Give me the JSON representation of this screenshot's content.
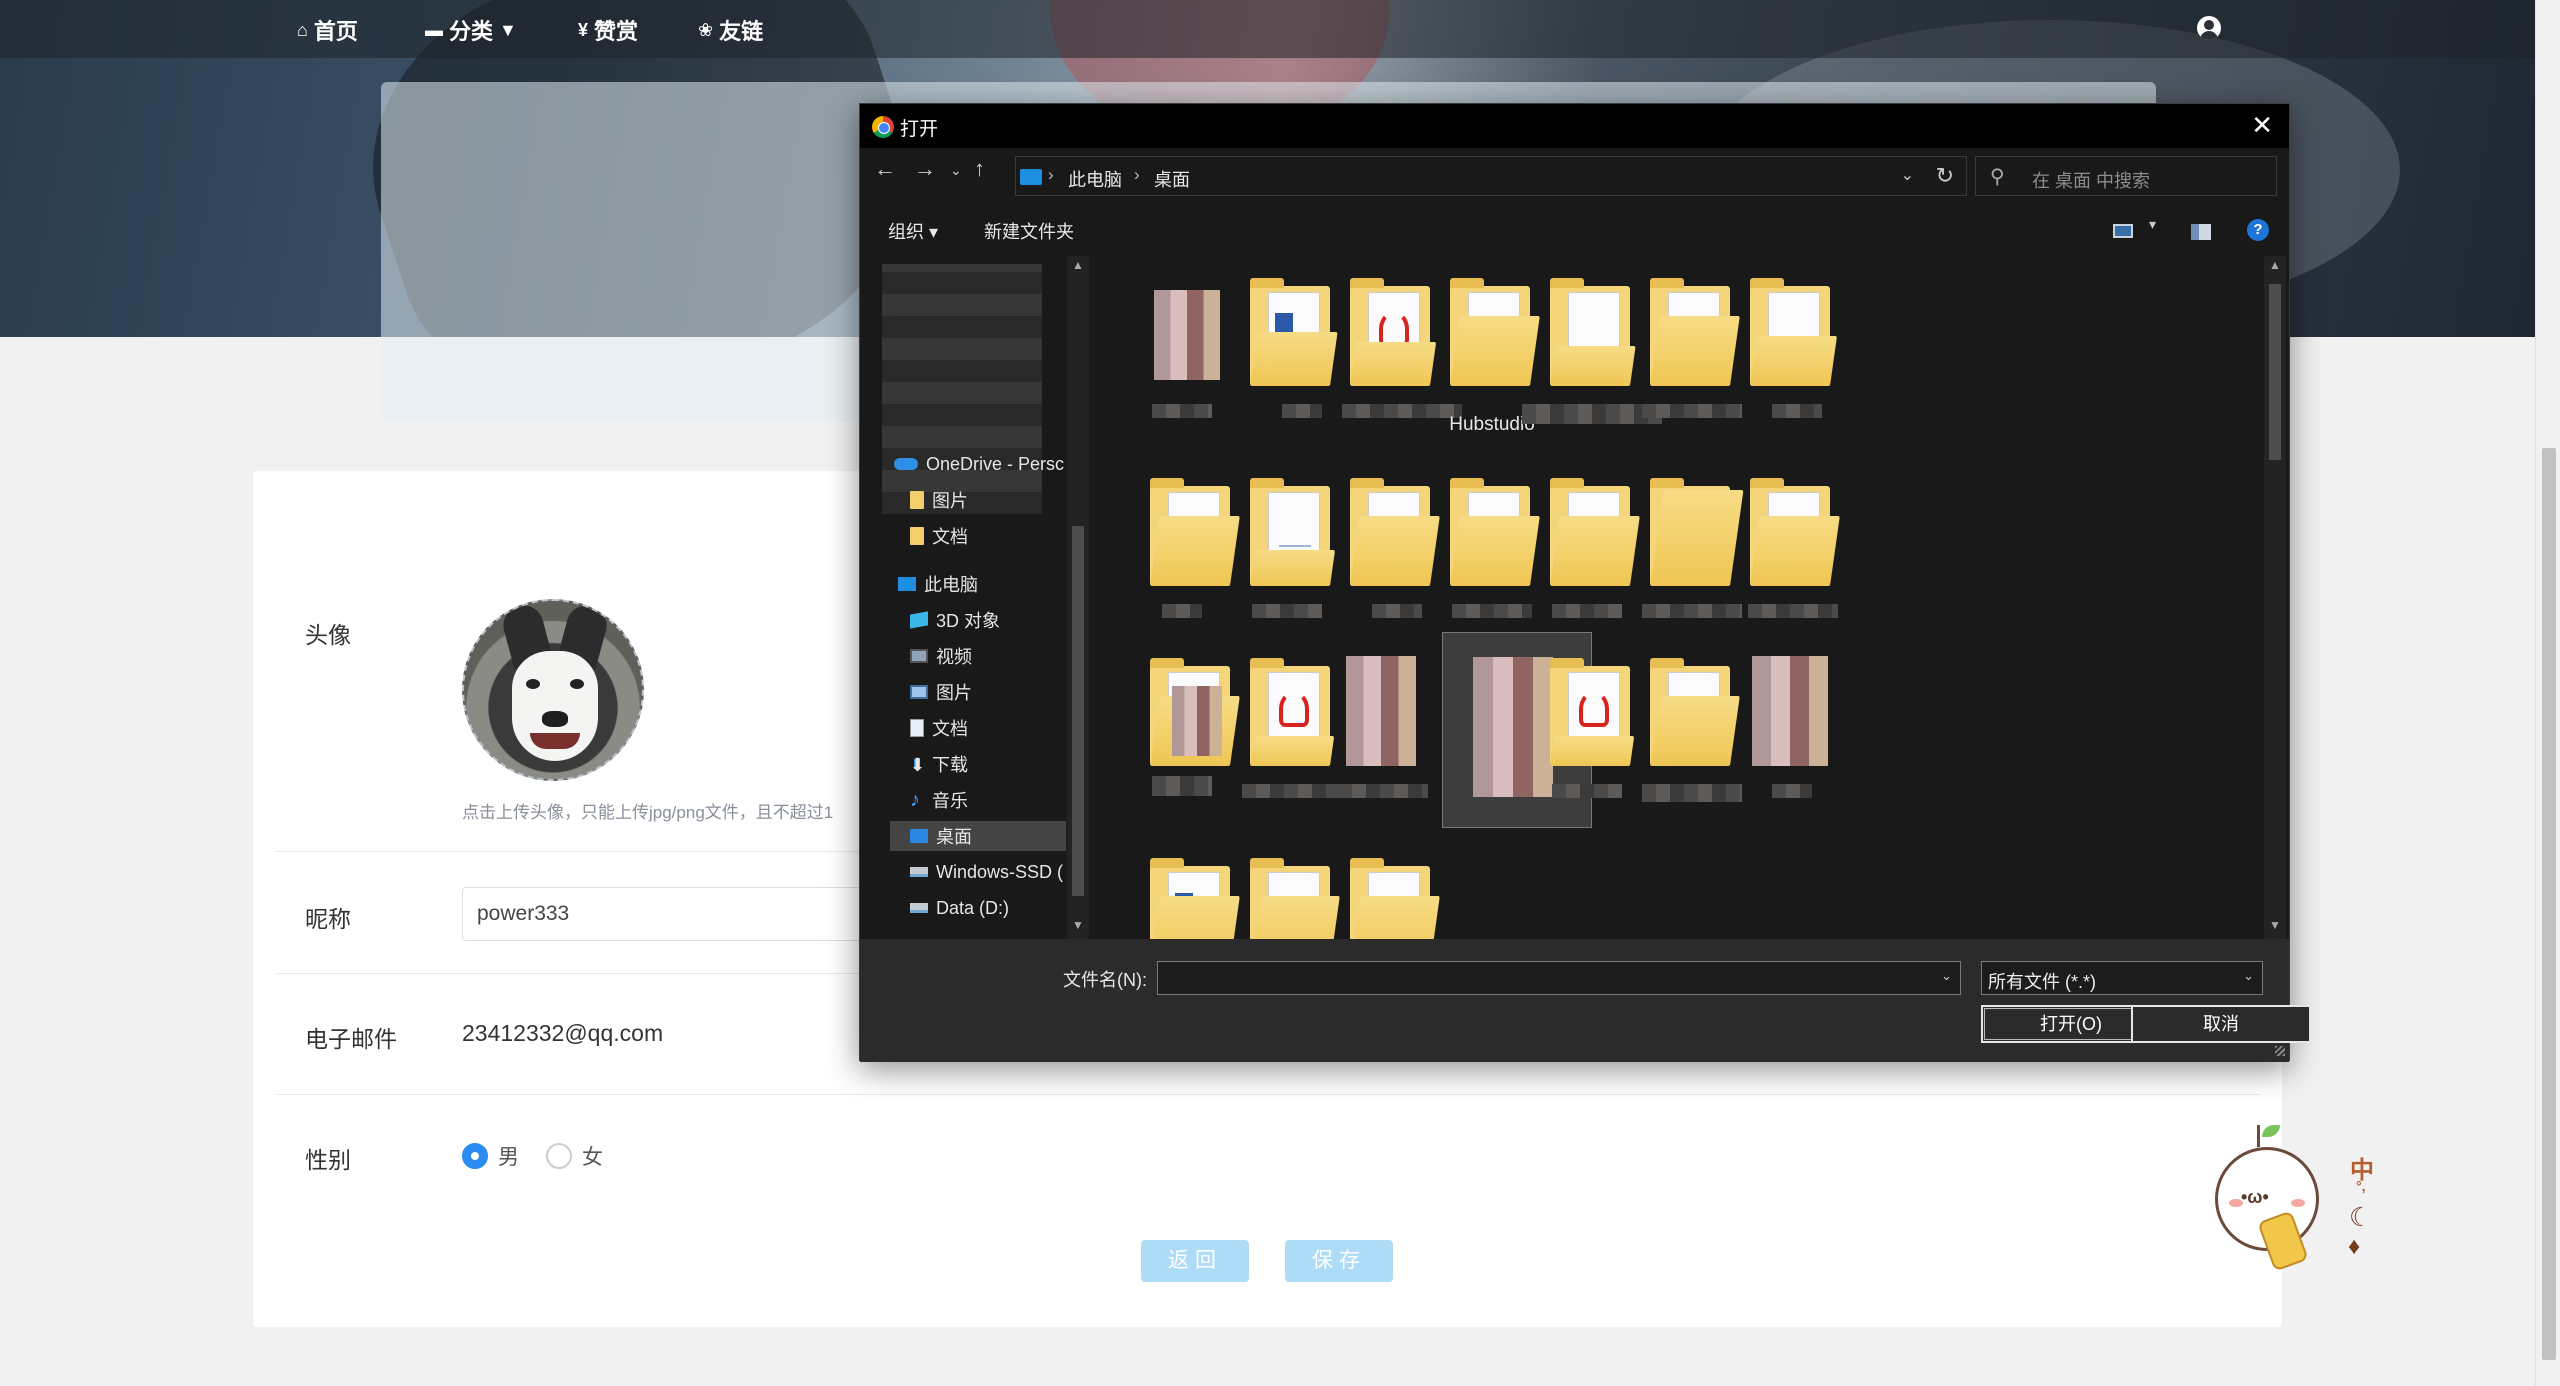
{
  "nav": {
    "home": "首页",
    "category": "分类",
    "reward": "赞赏",
    "links": "友链"
  },
  "profile": {
    "avatar_label": "头像",
    "upload_tip": "点击上传头像，只能上传jpg/png文件，且不超过1",
    "nickname_label": "昵称",
    "nickname_value": "power333",
    "email_label": "电子邮件",
    "email_value": "23412332@qq.com",
    "gender_label": "性别",
    "gender_male": "男",
    "gender_female": "女",
    "gender_selected": "男",
    "back_button": "返回",
    "save_button": "保存"
  },
  "ime": {
    "mode": "中"
  },
  "dialog": {
    "title": "打开",
    "breadcrumb": [
      "此电脑",
      "桌面"
    ],
    "search_placeholder": "在 桌面 中搜索",
    "toolbar": {
      "organize": "组织 ▾",
      "new_folder": "新建文件夹",
      "help": "?"
    },
    "nav_items": [
      {
        "label": "OneDrive - Persc",
        "icon": "cloud-icon"
      },
      {
        "label": "图片",
        "icon": "folder-icon"
      },
      {
        "label": "文档",
        "icon": "folder-icon"
      },
      {
        "label": "此电脑",
        "icon": "computer-icon"
      },
      {
        "label": "3D 对象",
        "icon": "cube-icon"
      },
      {
        "label": "视频",
        "icon": "film-icon"
      },
      {
        "label": "图片",
        "icon": "picture-icon"
      },
      {
        "label": "文档",
        "icon": "document-icon"
      },
      {
        "label": "下载",
        "icon": "download-icon"
      },
      {
        "label": "音乐",
        "icon": "music-icon"
      },
      {
        "label": "桌面",
        "icon": "desktop-icon",
        "selected": true
      },
      {
        "label": "Windows-SSD (",
        "icon": "drive-icon"
      },
      {
        "label": "Data (D:)",
        "icon": "drive-icon"
      }
    ],
    "files": {
      "named_folder": "Hubstudio"
    },
    "filename_label": "文件名(N):",
    "filename_value": "",
    "filetype_value": "所有文件 (*.*)",
    "open_button": "打开(O)",
    "cancel_button": "取消"
  }
}
